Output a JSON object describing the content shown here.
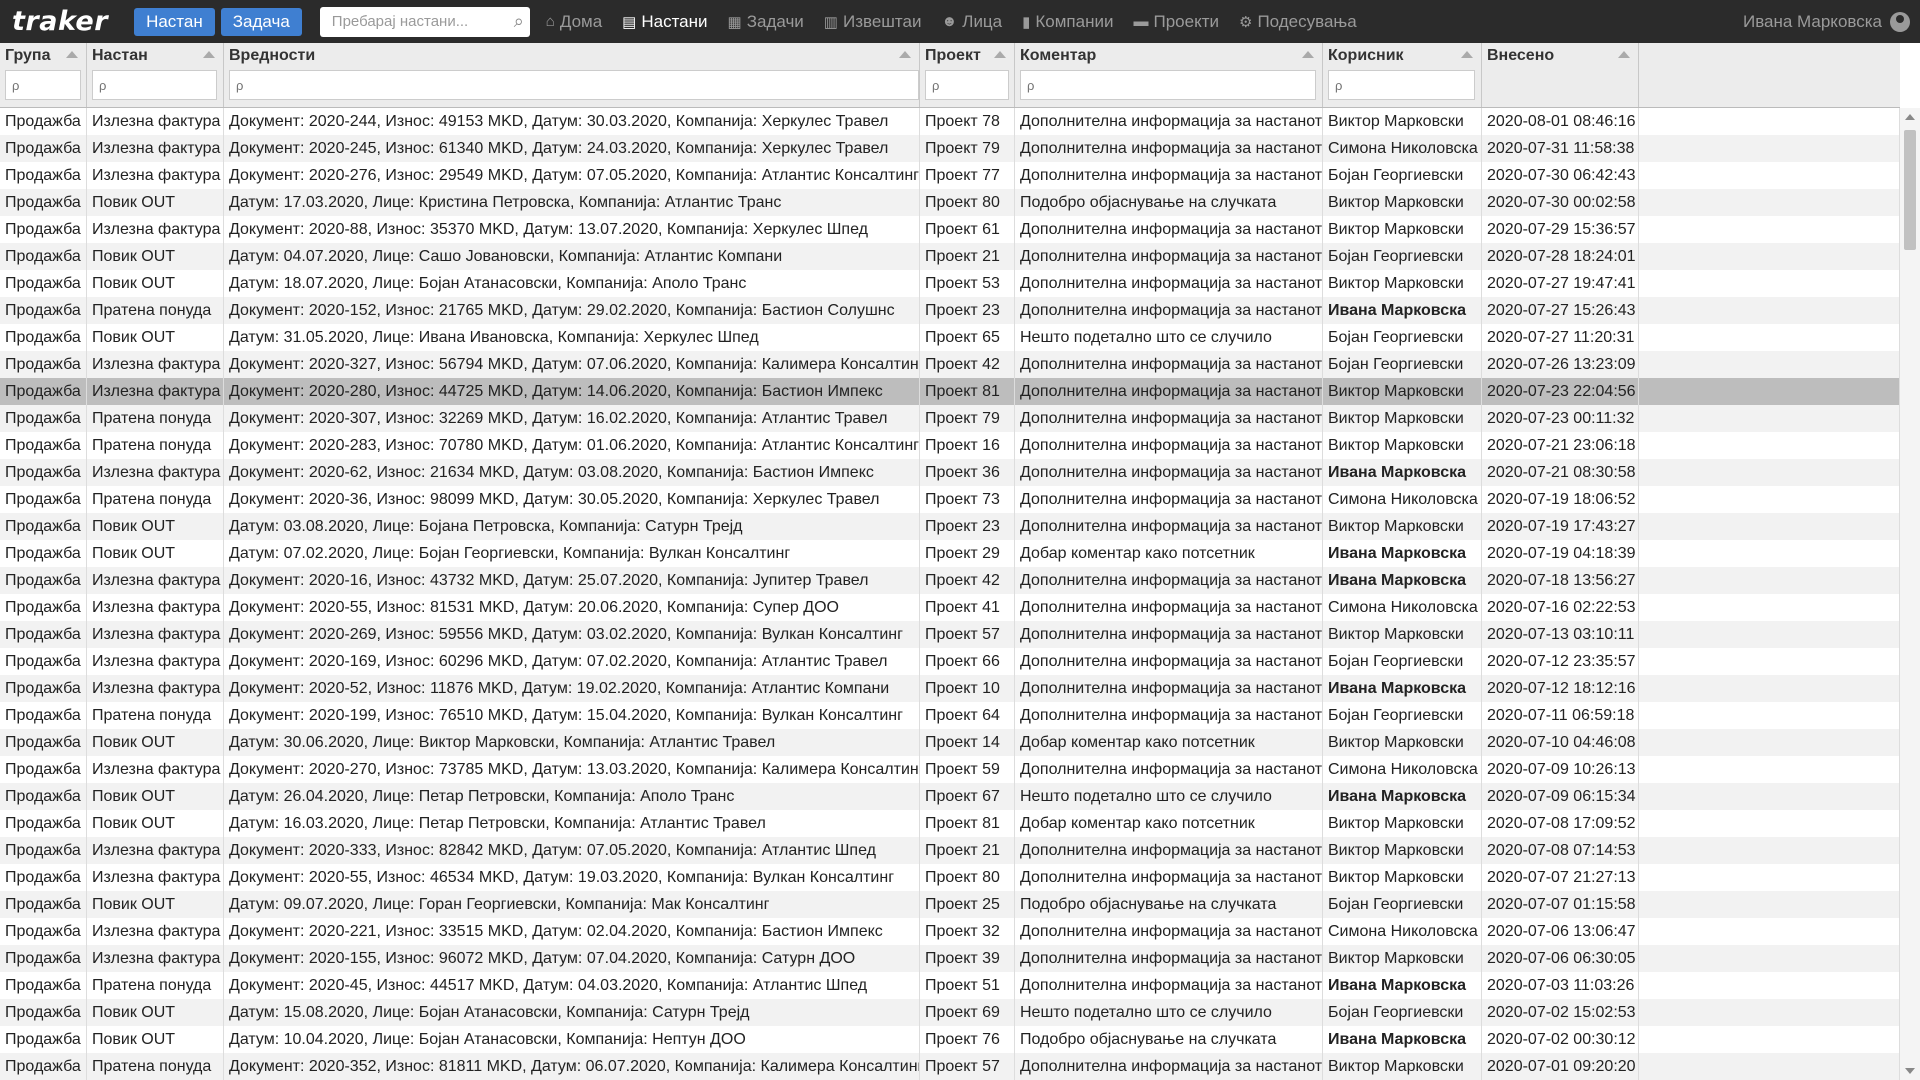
{
  "app": {
    "logo": "traker",
    "btn_event": "Настан",
    "btn_task": "Задача",
    "search_placeholder": "Пребарај настани...",
    "user_name": "Ивана Марковска"
  },
  "nav": [
    {
      "label": "Дома",
      "icon": "home-icon",
      "glyph": "⌂",
      "active": false
    },
    {
      "label": "Настани",
      "icon": "document-icon",
      "glyph": "▤",
      "active": true
    },
    {
      "label": "Задачи",
      "icon": "clipboard-icon",
      "glyph": "▦",
      "active": false
    },
    {
      "label": "Извештаи",
      "icon": "bar-chart-icon",
      "glyph": "▥",
      "active": false
    },
    {
      "label": "Лица",
      "icon": "person-icon",
      "glyph": "☻",
      "active": false
    },
    {
      "label": "Компании",
      "icon": "building-icon",
      "glyph": "▮",
      "active": false
    },
    {
      "label": "Проекти",
      "icon": "folder-icon",
      "glyph": "▬",
      "active": false
    },
    {
      "label": "Подесувања",
      "icon": "gear-icon",
      "glyph": "⚙",
      "active": false
    }
  ],
  "columns": [
    {
      "key": "group",
      "label": "Група",
      "filter_placeholder": "ρ"
    },
    {
      "key": "event",
      "label": "Настан",
      "filter_placeholder": "ρ"
    },
    {
      "key": "values",
      "label": "Вредности",
      "filter_placeholder": "ρ"
    },
    {
      "key": "project",
      "label": "Проект",
      "filter_placeholder": "ρ"
    },
    {
      "key": "comment",
      "label": "Коментар",
      "filter_placeholder": "ρ"
    },
    {
      "key": "user",
      "label": "Корисник",
      "filter_placeholder": "ρ"
    },
    {
      "key": "entered",
      "label": "Внесено",
      "filter_placeholder": ""
    }
  ],
  "rows": [
    [
      "Продажба",
      "Излезна фактура",
      "Документ: 2020-244, Износ: 49153 MKD, Датум: 30.03.2020, Компанија: Херкулес Травел",
      "Проект 78",
      "Дополнителна информација за настанот",
      "Виктор Марковски",
      "2020-08-01 08:46:16"
    ],
    [
      "Продажба",
      "Излезна фактура",
      "Документ: 2020-245, Износ: 61340 MKD, Датум: 24.03.2020, Компанија: Херкулес Травел",
      "Проект 79",
      "Дополнителна информација за настанот",
      "Симона Николовска",
      "2020-07-31 11:58:38"
    ],
    [
      "Продажба",
      "Излезна фактура",
      "Документ: 2020-276, Износ: 29549 MKD, Датум: 07.05.2020, Компанија: Атлантис Консалтинг",
      "Проект 77",
      "Дополнителна информација за настанот",
      "Бојан Георгиевски",
      "2020-07-30 06:42:43"
    ],
    [
      "Продажба",
      "Повик OUT",
      "Датум: 17.03.2020, Лице: Кристина Петровска, Компанија: Атлантис Транс",
      "Проект 80",
      "Подобро објаснување на случката",
      "Виктор Марковски",
      "2020-07-30 00:02:58"
    ],
    [
      "Продажба",
      "Излезна фактура",
      "Документ: 2020-88, Износ: 35370 MKD, Датум: 13.07.2020, Компанија: Херкулес Шпед",
      "Проект 61",
      "Дополнителна информација за настанот",
      "Виктор Марковски",
      "2020-07-29 15:36:57"
    ],
    [
      "Продажба",
      "Повик OUT",
      "Датум: 04.07.2020, Лице: Сашо Јовановски, Компанија: Атлантис Компани",
      "Проект 21",
      "Дополнителна информација за настанот",
      "Бојан Георгиевски",
      "2020-07-28 18:24:01"
    ],
    [
      "Продажба",
      "Повик OUT",
      "Датум: 18.07.2020, Лице: Бојан Атанасовски, Компанија: Аполо Транс",
      "Проект 53",
      "Дополнителна информација за настанот",
      "Виктор Марковски",
      "2020-07-27 19:47:41"
    ],
    [
      "Продажба",
      "Пратена понуда",
      "Документ: 2020-152, Износ: 21765 MKD, Датум: 29.02.2020, Компанија: Бастион Солушнс",
      "Проект 23",
      "Дополнителна информација за настанот",
      "Ивана Марковска",
      "2020-07-27 15:26:43"
    ],
    [
      "Продажба",
      "Повик OUT",
      "Датум: 31.05.2020, Лице: Ивана Ивановска, Компанија: Херкулес Шпед",
      "Проект 65",
      "Нешто подетално што се случило",
      "Бојан Георгиевски",
      "2020-07-27 11:20:31"
    ],
    [
      "Продажба",
      "Излезна фактура",
      "Документ: 2020-327, Износ: 56794 MKD, Датум: 07.06.2020, Компанија: Калимера Консалтинг",
      "Проект 42",
      "Дополнителна информација за настанот",
      "Бојан Георгиевски",
      "2020-07-26 13:23:09"
    ],
    [
      "Продажба",
      "Излезна фактура",
      "Документ: 2020-280, Износ: 44725 MKD, Датум: 14.06.2020, Компанија: Бастион Импекс",
      "Проект 81",
      "Дополнителна информација за настанот",
      "Виктор Марковски",
      "2020-07-23 22:04:56"
    ],
    [
      "Продажба",
      "Пратена понуда",
      "Документ: 2020-307, Износ: 32269 MKD, Датум: 16.02.2020, Компанија: Атлантис Травел",
      "Проект 79",
      "Дополнителна информација за настанот",
      "Виктор Марковски",
      "2020-07-23 00:11:32"
    ],
    [
      "Продажба",
      "Пратена понуда",
      "Документ: 2020-283, Износ: 70780 MKD, Датум: 01.06.2020, Компанија: Атлантис Консалтинг",
      "Проект 16",
      "Дополнителна информација за настанот",
      "Виктор Марковски",
      "2020-07-21 23:06:18"
    ],
    [
      "Продажба",
      "Излезна фактура",
      "Документ: 2020-62, Износ: 21634 MKD, Датум: 03.08.2020, Компанија: Бастион Импекс",
      "Проект 36",
      "Дополнителна информација за настанот",
      "Ивана Марковска",
      "2020-07-21 08:30:58"
    ],
    [
      "Продажба",
      "Пратена понуда",
      "Документ: 2020-36, Износ: 98099 MKD, Датум: 30.05.2020, Компанија: Херкулес Травел",
      "Проект 73",
      "Дополнителна информација за настанот",
      "Симона Николовска",
      "2020-07-19 18:06:52"
    ],
    [
      "Продажба",
      "Повик OUT",
      "Датум: 03.08.2020, Лице: Бојана Петровска, Компанија: Сатурн Трејд",
      "Проект 23",
      "Дополнителна информација за настанот",
      "Виктор Марковски",
      "2020-07-19 17:43:27"
    ],
    [
      "Продажба",
      "Повик OUT",
      "Датум: 07.02.2020, Лице: Бојан Георгиевски, Компанија: Вулкан Консалтинг",
      "Проект 29",
      "Добар коментар како потсетник",
      "Ивана Марковска",
      "2020-07-19 04:18:39"
    ],
    [
      "Продажба",
      "Излезна фактура",
      "Документ: 2020-16, Износ: 43732 MKD, Датум: 25.07.2020, Компанија: Јупитер Травел",
      "Проект 42",
      "Дополнителна информација за настанот",
      "Ивана Марковска",
      "2020-07-18 13:56:27"
    ],
    [
      "Продажба",
      "Излезна фактура",
      "Документ: 2020-55, Износ: 81531 MKD, Датум: 20.06.2020, Компанија: Супер ДОО",
      "Проект 41",
      "Дополнителна информација за настанот",
      "Симона Николовска",
      "2020-07-16 02:22:53"
    ],
    [
      "Продажба",
      "Излезна фактура",
      "Документ: 2020-269, Износ: 59556 MKD, Датум: 03.02.2020, Компанија: Вулкан Консалтинг",
      "Проект 57",
      "Дополнителна информација за настанот",
      "Виктор Марковски",
      "2020-07-13 03:10:11"
    ],
    [
      "Продажба",
      "Излезна фактура",
      "Документ: 2020-169, Износ: 60296 MKD, Датум: 07.02.2020, Компанија: Атлантис Травел",
      "Проект 66",
      "Дополнителна информација за настанот",
      "Бојан Георгиевски",
      "2020-07-12 23:35:57"
    ],
    [
      "Продажба",
      "Излезна фактура",
      "Документ: 2020-52, Износ: 11876 MKD, Датум: 19.02.2020, Компанија: Атлантис Компани",
      "Проект 10",
      "Дополнителна информација за настанот",
      "Ивана Марковска",
      "2020-07-12 18:12:16"
    ],
    [
      "Продажба",
      "Пратена понуда",
      "Документ: 2020-199, Износ: 76510 MKD, Датум: 15.04.2020, Компанија: Вулкан Консалтинг",
      "Проект 64",
      "Дополнителна информација за настанот",
      "Бојан Георгиевски",
      "2020-07-11 06:59:18"
    ],
    [
      "Продажба",
      "Повик OUT",
      "Датум: 30.06.2020, Лице: Виктор Марковски, Компанија: Атлантис Травел",
      "Проект 14",
      "Добар коментар како потсетник",
      "Виктор Марковски",
      "2020-07-10 04:46:08"
    ],
    [
      "Продажба",
      "Излезна фактура",
      "Документ: 2020-270, Износ: 73785 MKD, Датум: 13.03.2020, Компанија: Калимера Консалтинг",
      "Проект 59",
      "Дополнителна информација за настанот",
      "Симона Николовска",
      "2020-07-09 10:26:13"
    ],
    [
      "Продажба",
      "Повик OUT",
      "Датум: 26.04.2020, Лице: Петар Петровски, Компанија: Аполо Транс",
      "Проект 67",
      "Нешто подетално што се случило",
      "Ивана Марковска",
      "2020-07-09 06:15:34"
    ],
    [
      "Продажба",
      "Повик OUT",
      "Датум: 16.03.2020, Лице: Петар Петровски, Компанија: Атлантис Травел",
      "Проект 81",
      "Добар коментар како потсетник",
      "Виктор Марковски",
      "2020-07-08 17:09:52"
    ],
    [
      "Продажба",
      "Излезна фактура",
      "Документ: 2020-333, Износ: 82842 MKD, Датум: 07.05.2020, Компанија: Атлантис Шпед",
      "Проект 21",
      "Дополнителна информација за настанот",
      "Виктор Марковски",
      "2020-07-08 07:14:53"
    ],
    [
      "Продажба",
      "Излезна фактура",
      "Документ: 2020-55, Износ: 46534 MKD, Датум: 19.03.2020, Компанија: Вулкан Консалтинг",
      "Проект 80",
      "Дополнителна информација за настанот",
      "Виктор Марковски",
      "2020-07-07 21:27:13"
    ],
    [
      "Продажба",
      "Повик OUT",
      "Датум: 09.07.2020, Лице: Горан Георгиевски, Компанија: Мак Консалтинг",
      "Проект 25",
      "Подобро објаснување на случката",
      "Бојан Георгиевски",
      "2020-07-07 01:15:58"
    ],
    [
      "Продажба",
      "Излезна фактура",
      "Документ: 2020-221, Износ: 33515 MKD, Датум: 02.04.2020, Компанија: Бастион Импекс",
      "Проект 32",
      "Дополнителна информација за настанот",
      "Симона Николовска",
      "2020-07-06 13:06:47"
    ],
    [
      "Продажба",
      "Излезна фактура",
      "Документ: 2020-155, Износ: 96072 MKD, Датум: 07.04.2020, Компанија: Сатурн ДОО",
      "Проект 39",
      "Дополнителна информација за настанот",
      "Виктор Марковски",
      "2020-07-06 06:30:05"
    ],
    [
      "Продажба",
      "Пратена понуда",
      "Документ: 2020-45, Износ: 44517 MKD, Датум: 04.03.2020, Компанија: Атлантис Шпед",
      "Проект 51",
      "Дополнителна информација за настанот",
      "Ивана Марковска",
      "2020-07-03 11:03:26"
    ],
    [
      "Продажба",
      "Повик OUT",
      "Датум: 15.08.2020, Лице: Бојан Атанасовски, Компанија: Сатурн Трејд",
      "Проект 69",
      "Нешто подетално што се случило",
      "Бојан Георгиевски",
      "2020-07-02 15:02:53"
    ],
    [
      "Продажба",
      "Повик OUT",
      "Датум: 10.04.2020, Лице: Бојан Атанасовски, Компанија: Нептун ДОО",
      "Проект 76",
      "Подобро објаснување на случката",
      "Ивана Марковска",
      "2020-07-02 00:30:12"
    ],
    [
      "Продажба",
      "Пратена понуда",
      "Документ: 2020-352, Износ: 81811 MKD, Датум: 06.07.2020, Компанија: Калимера Консалтинг",
      "Проект 57",
      "Дополнителна информација за настанот",
      "Виктор Марковски",
      "2020-07-01 09:20:20"
    ]
  ],
  "selected_row": 10,
  "bold_user": "Ивана Марковска"
}
